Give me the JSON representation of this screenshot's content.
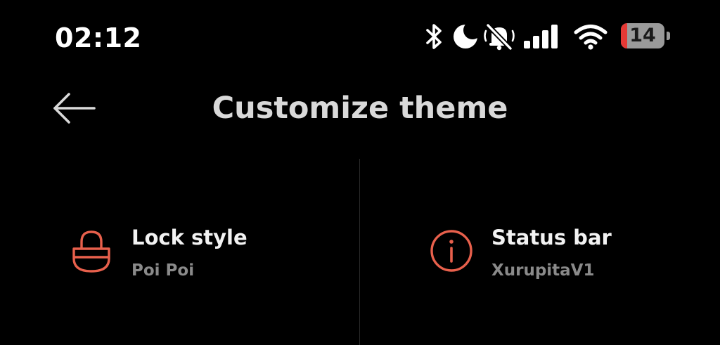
{
  "status_bar": {
    "time": "02:12",
    "battery_level": "14",
    "battery_fraction": 0.14,
    "icons": [
      "bluetooth-icon",
      "moon-icon",
      "vibrate-mute-icon",
      "signal-icon",
      "wifi-icon",
      "battery-icon"
    ]
  },
  "header": {
    "title": "Customize theme",
    "back_icon": "arrow-left-icon"
  },
  "items": [
    {
      "title": "Lock style",
      "subtitle": "Poi Poi",
      "icon": "lock-icon"
    },
    {
      "title": "Status bar",
      "subtitle": "XurupitaV1",
      "icon": "info-icon"
    }
  ],
  "colors": {
    "background": "#000000",
    "accent": "#e8604c",
    "battery_low": "#e53935",
    "title_text": "#d9d9d9",
    "item_title": "#f2f2f2",
    "item_subtitle": "#8a8a8a"
  }
}
